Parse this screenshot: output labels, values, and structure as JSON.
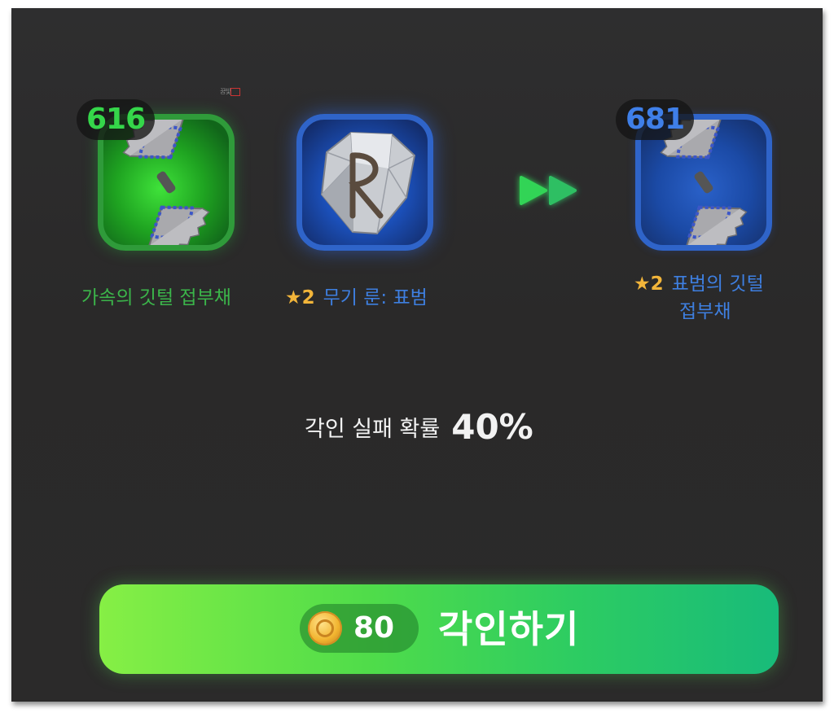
{
  "source_item": {
    "level": "616",
    "name": "가속의 깃털 접부채",
    "icon": "feather-fan-icon",
    "frame_color": "#2f9b3a"
  },
  "rune_item": {
    "stars": "★2",
    "name": "무기 룬: 표범",
    "icon": "rune-stone-icon",
    "frame_color": "#2f64c9"
  },
  "result_item": {
    "level": "681",
    "stars": "★2",
    "name_line1": "표범의 깃털",
    "name_line2": "접부채",
    "icon": "feather-fan-icon",
    "frame_color": "#2f64c9"
  },
  "transition_icon": "double-arrow-right-icon",
  "failure": {
    "label": "각인 실패 확률",
    "value": "40%"
  },
  "engrave_button": {
    "cost": "80",
    "currency_icon": "gold-coin-icon",
    "label": "각인하기"
  },
  "colors": {
    "green": "#3bb54a",
    "blue": "#3e7fe0",
    "star": "#f2b53a"
  }
}
